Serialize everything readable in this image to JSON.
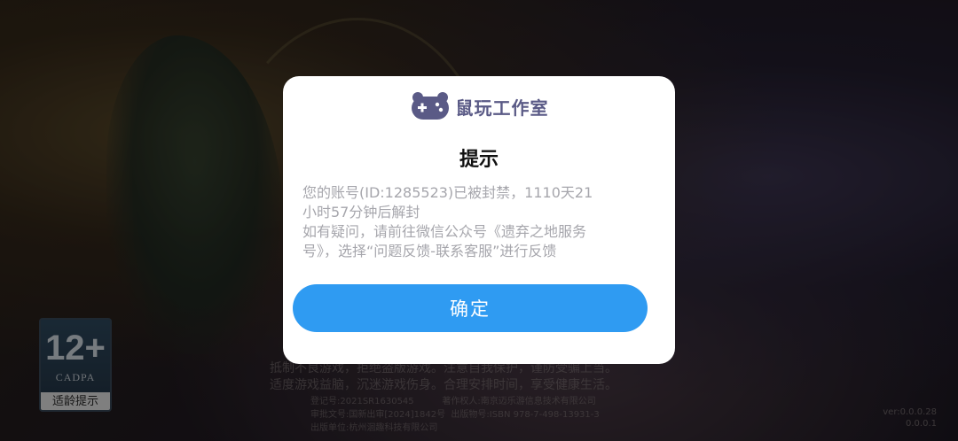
{
  "age_rating": {
    "number": "12+",
    "org": "CADPA",
    "label": "适龄提示"
  },
  "footer": {
    "notice_line1": "抵制不良游戏，拒绝盗版游戏。注意自我保护，谨防受骗上当。",
    "notice_line2": "适度游戏益脑，沉迷游戏伤身。合理安排时间，享受健康生活。",
    "legal_line1": "登记号:2021SR1630545          著作权人:南京迈乐游信息技术有限公司",
    "legal_line2": "审批文号:国新出审[2024]1842号  出版物号:ISBN 978-7-498-13931-3",
    "legal_line3": "出版单位:杭州洄趣科技有限公司",
    "version_line1": "ver:0.0.0.28",
    "version_line2": "0.0.0.1"
  },
  "dialog": {
    "brand_name": "鼠玩工作室",
    "brand_icon": "gamepad-mouse-icon",
    "title": "提示",
    "message_line1": "您的账号(ID:1285523)已被封禁，1110天21",
    "message_line2": "小时57分钟后解封",
    "message_line3": "如有疑问，请前往微信公众号《遗弃之地服务",
    "message_line4": "号》，选择“问题反馈-联系客服”进行反馈",
    "confirm_label": "确定"
  },
  "colors": {
    "confirm_button": "#2f9bf2",
    "brand": "#5a5a86",
    "message_text": "#a6a6ac"
  }
}
